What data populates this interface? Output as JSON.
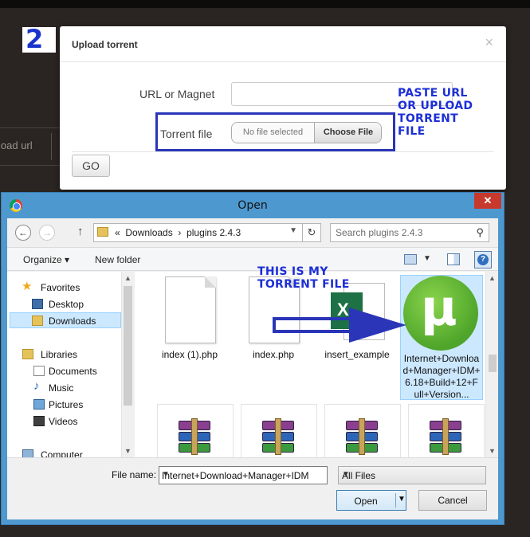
{
  "step_badge": "2",
  "background": {
    "partial_text": "load url"
  },
  "upload_modal": {
    "title": "Upload torrent",
    "close": "×",
    "url_label": "URL or Magnet",
    "url_value": "",
    "torrent_label": "Torrent file",
    "file_status": "No file selected",
    "choose_file": "Choose File",
    "go": "GO"
  },
  "annotations": {
    "paste": "PASTE URL\nOR UPLOAD\nTORRENT\nFILE",
    "mine": "THIS IS MY\nTORRENT FILE",
    "color": "#1c2fd6"
  },
  "open_dialog": {
    "title": "Open",
    "close": "✕",
    "address": {
      "prefix": "«",
      "parts": [
        "Downloads",
        "plugins 2.4.3"
      ],
      "separator": "›"
    },
    "search_placeholder": "Search plugins 2.4.3",
    "toolbar": {
      "organize": "Organize ▾",
      "new_folder": "New folder",
      "help": "?"
    },
    "nav": {
      "favorites": "Favorites",
      "desktop": "Desktop",
      "downloads": "Downloads",
      "libraries": "Libraries",
      "documents": "Documents",
      "music": "Music",
      "pictures": "Pictures",
      "videos": "Videos",
      "computer": "Computer"
    },
    "files": [
      {
        "name": "index (1).php",
        "icon": "php-file-icon"
      },
      {
        "name": "index.php",
        "icon": "php-file-icon"
      },
      {
        "name": "insert_example",
        "icon": "excel-file-icon"
      },
      {
        "name": "Internet+Download+Manager+IDM+6.18+Build+12+Full+Version...",
        "icon": "utorrent-file-icon",
        "selected": true
      },
      {
        "name": "",
        "icon": "winrar-archive-icon"
      },
      {
        "name": "",
        "icon": "winrar-archive-icon"
      },
      {
        "name": "",
        "icon": "winrar-archive-icon"
      },
      {
        "name": "",
        "icon": "winrar-archive-icon"
      }
    ],
    "file_name_label": "File name:",
    "file_name_value": "Internet+Download+Manager+IDM",
    "file_type": "All Files",
    "open_button": "Open",
    "cancel_button": "Cancel"
  },
  "colors": {
    "accent": "#2a35b8",
    "title_bar": "#4e98d0",
    "selection": "#cce8ff"
  }
}
